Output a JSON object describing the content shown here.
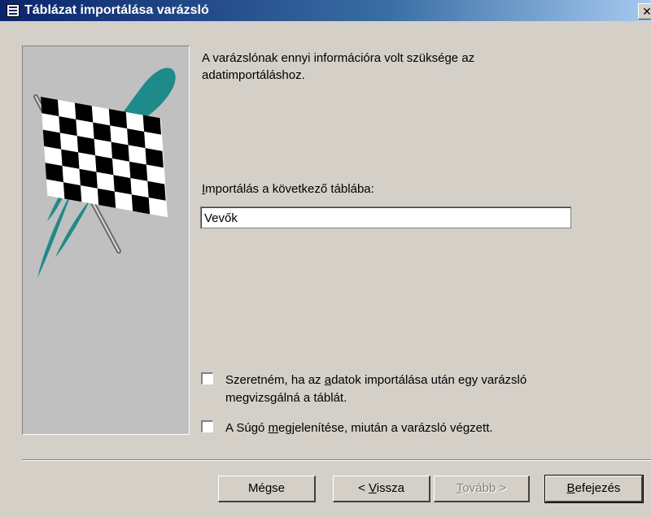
{
  "window": {
    "title": "Táblázat importálása varázsló",
    "close_glyph": "✕"
  },
  "info_text": "A varázslónak ennyi információra volt szüksége az adatimportáláshoz.",
  "import_label": {
    "before": "",
    "mnemonic": "I",
    "after": "mportálás a következő táblába:"
  },
  "table_name": {
    "value": "Vevők"
  },
  "options": [
    {
      "label_before": "Szeretném, ha az ",
      "mnemonic": "a",
      "label_after": "datok importálása után egy varázsló megvizsgálná a táblát.",
      "checked": false
    },
    {
      "label_before": "A Súgó ",
      "mnemonic": "m",
      "label_after": "egjelenítése, miután a varázsló végzett.",
      "checked": false
    }
  ],
  "buttons": {
    "cancel": {
      "label": "Mégse"
    },
    "back": {
      "before": "< ",
      "mnemonic": "V",
      "after": "issza"
    },
    "next": {
      "before": "",
      "mnemonic": "T",
      "after": "ovább >",
      "disabled": true
    },
    "finish": {
      "before": "",
      "mnemonic": "B",
      "after": "efejezés"
    }
  },
  "colors": {
    "titlebar_start": "#0a246a",
    "dialog_bg": "#d4d0c8",
    "art_panel": "#c0c0c0",
    "art_teal": "#1f8a8a"
  },
  "icons": {
    "app": "form-icon",
    "art": "checkered-flag-icon"
  }
}
